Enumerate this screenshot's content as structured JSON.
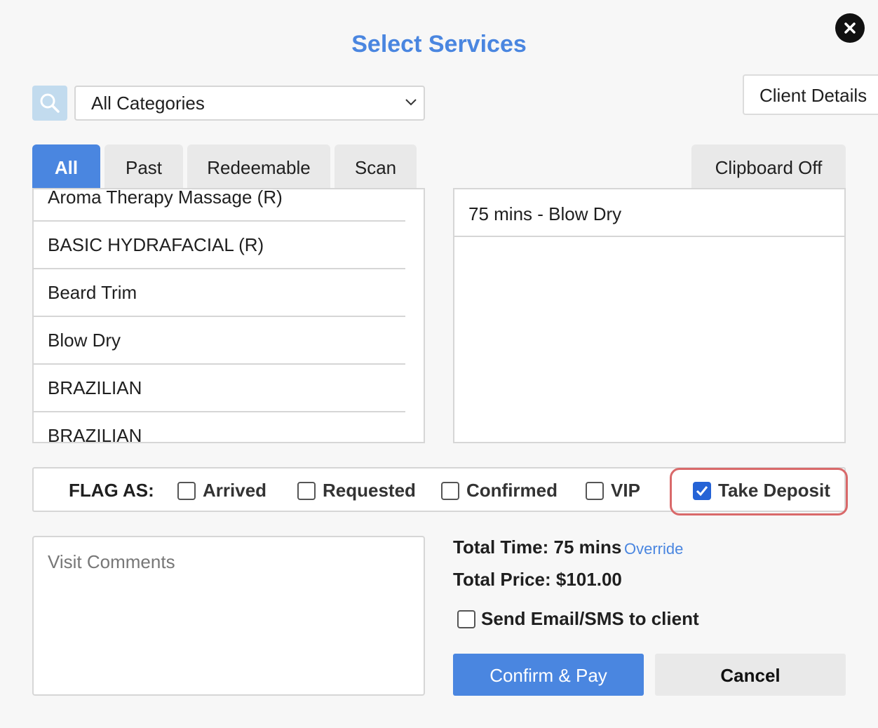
{
  "dialog": {
    "title": "Select Services",
    "client_details_label": "Client Details"
  },
  "filter": {
    "category_selected": "All Categories"
  },
  "tabs": [
    {
      "label": "All",
      "active": true
    },
    {
      "label": "Past",
      "active": false
    },
    {
      "label": "Redeemable",
      "active": false
    },
    {
      "label": "Scan",
      "active": false
    }
  ],
  "clipboard_label": "Clipboard Off",
  "services": [
    "Aroma Therapy Massage (R)",
    "BASIC HYDRAFACIAL (R)",
    "Beard Trim",
    "Blow Dry",
    "BRAZILIAN",
    "BRAZILIAN"
  ],
  "selected_services": [
    "75 mins - Blow Dry"
  ],
  "flags": {
    "label": "FLAG AS:",
    "options": [
      {
        "label": "Arrived",
        "checked": false
      },
      {
        "label": "Requested",
        "checked": false
      },
      {
        "label": "Confirmed",
        "checked": false
      },
      {
        "label": "VIP",
        "checked": false
      },
      {
        "label": "Take Deposit",
        "checked": true
      }
    ]
  },
  "comments": {
    "placeholder": "Visit Comments"
  },
  "totals": {
    "time_text": "Total Time: 75 mins",
    "override_label": "Override",
    "price_text": "Total Price: $101.00"
  },
  "notify": {
    "label": "Send Email/SMS to client",
    "checked": false
  },
  "actions": {
    "confirm_label": "Confirm & Pay",
    "cancel_label": "Cancel"
  },
  "colors": {
    "accent": "#4a86e0",
    "highlight": "#d9696a",
    "checkbox_checked": "#2563d6"
  }
}
